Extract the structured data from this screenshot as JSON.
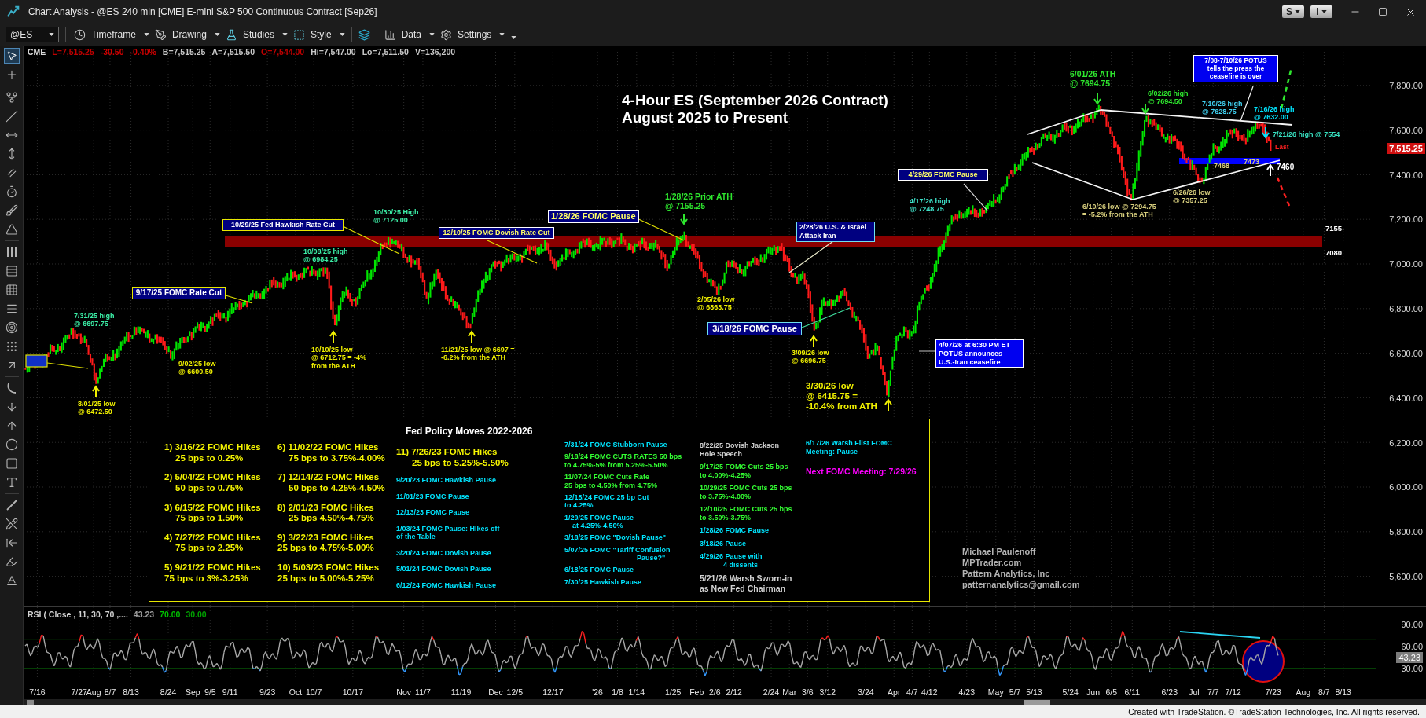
{
  "window": {
    "title": "Chart Analysis - @ES 240 min [CME] E-mini S&P 500 Continuous Contract [Sep26]",
    "buttons": [
      "S",
      "I"
    ]
  },
  "toolbar": {
    "symbol": "@ES",
    "menus": [
      "Timeframe",
      "Drawing",
      "Studies",
      "Style",
      "Data",
      "Settings"
    ]
  },
  "tools": [
    {
      "selected": true
    },
    {
      "selected": false
    },
    {
      "selected": false
    },
    {
      "selected": false
    },
    {
      "selected": false
    },
    {
      "selected": false
    },
    {
      "selected": false
    },
    {
      "selected": false
    },
    {
      "selected": false
    },
    {
      "selected": false
    },
    {
      "selected": false
    },
    {
      "selected": false
    },
    {
      "selected": false
    },
    {
      "selected": false
    },
    {
      "selected": false
    },
    {
      "selected": false
    },
    {
      "selected": false
    },
    {
      "selected": false
    },
    {
      "selected": false
    },
    {
      "selected": false
    },
    {
      "selected": false
    },
    {
      "selected": false
    },
    {
      "selected": false
    },
    {
      "selected": false
    },
    {
      "selected": false
    },
    {
      "selected": false
    },
    {
      "selected": false
    },
    {
      "selected": false
    }
  ],
  "quote": [
    {
      "text": "CME",
      "color": "#d8d8d8"
    },
    {
      "text": "L=7,515.25",
      "color": "#c00000"
    },
    {
      "text": "-30.50",
      "color": "#d00000"
    },
    {
      "text": "-0.40%",
      "color": "#d00000"
    },
    {
      "text": "B=7,515.25",
      "color": "#c8c8c8"
    },
    {
      "text": "A=7,515.50",
      "color": "#c8c8c8"
    },
    {
      "text": "O=7,544.00",
      "color": "#c00000"
    },
    {
      "text": "Hi=7,547.00",
      "color": "#c8c8c8"
    },
    {
      "text": "Lo=7,511.50",
      "color": "#c8c8c8"
    },
    {
      "text": "V=136,200",
      "color": "#c8c8c8"
    }
  ],
  "chart": {
    "title": [
      "4-Hour ES (September 2026 Contract)",
      "August 2025 to Present"
    ],
    "callouts": [
      {
        "lines": [
          "7/08-7/10/26 POTUS",
          "tells the press the",
          "ceasefire is over"
        ],
        "kind": "news"
      },
      {
        "lines": [
          "4/29/26 FOMC Pause"
        ],
        "kind": "fomc"
      },
      {
        "lines": [
          "10/29/25 Fed Hawkish Rate Cut"
        ],
        "kind": "fed"
      },
      {
        "lines": [
          "12/10/25 FOMC Dovish Rate Cut"
        ],
        "kind": "fomc"
      },
      {
        "lines": [
          "1/28/26 FOMC Pause"
        ],
        "kind": "fomc"
      },
      {
        "lines": [
          "2/28/26 U.S. & Israel",
          "Attack Iran"
        ],
        "kind": "event"
      },
      {
        "lines": [
          "9/17/25 FOMC Rate Cut"
        ],
        "kind": "fed"
      },
      {
        "lines": [
          "3/18/26 FOMC Pause"
        ],
        "kind": "event"
      },
      {
        "lines": [
          "4/07/26 at 6:30 PM ET",
          "POTUS announces",
          "U.S.-Iran ceasefire"
        ],
        "kind": "news"
      }
    ],
    "notes": [
      {
        "lines": [
          "6/01/26 ATH",
          "@ 7694.75"
        ],
        "color": "#2ee62e"
      },
      {
        "lines": [
          "6/02/26 high",
          "@ 7694.50"
        ],
        "color": "#2ee62e"
      },
      {
        "lines": [
          "7/10/26 high",
          "@ 7628.75"
        ],
        "color": "#40d0f0"
      },
      {
        "lines": [
          "7/16/26 high",
          "@ 7632.00"
        ],
        "color": "#00e5ff"
      },
      {
        "lines": [
          "7/21/26 high @ 7554"
        ],
        "color": "#38e0c0"
      },
      {
        "lines": [
          "Last"
        ],
        "color": "#ff2020"
      },
      {
        "lines": [
          "7460"
        ],
        "color": "#ffffff"
      },
      {
        "lines": [
          "4/17/26 high",
          "@ 7248.75"
        ],
        "color": "#3ee0c8"
      },
      {
        "lines": [
          "6/10/26 low @ 7294.75",
          "= -5.2% from the ATH"
        ],
        "color": "#d8cf7e"
      },
      {
        "lines": [
          "6/26/26 low",
          "@ 7357.25"
        ],
        "color": "#d8cf7e"
      },
      {
        "lines": [
          "1/28/26 Prior ATH",
          "@ 7155.25"
        ],
        "color": "#2ee62e"
      },
      {
        "lines": [
          "10/30/25 High",
          "@ 7125.00"
        ],
        "color": "#3cf0a8"
      },
      {
        "lines": [
          "10/08/25 high",
          "@ 6984.25"
        ],
        "color": "#3cf0a8"
      },
      {
        "lines": [
          "2/05/26 low",
          "@ 6863.75"
        ],
        "color": "#f0f000"
      },
      {
        "lines": [
          "7/31/25 high",
          "@ 6697.75"
        ],
        "color": "#3cf0a8"
      },
      {
        "lines": [
          "10/10/25 low",
          "@ 6712.75 = -4%",
          "from the ATH"
        ],
        "color": "#f0f000"
      },
      {
        "lines": [
          "11/21/25 low @ 6697 =",
          "-6.2% from the ATH"
        ],
        "color": "#f0f000"
      },
      {
        "lines": [
          "3/09/26 low",
          "@ 6696.75"
        ],
        "color": "#f0f000"
      },
      {
        "lines": [
          "9/02/25 low",
          "@ 6600.50"
        ],
        "color": "#f0f000"
      },
      {
        "lines": [
          "3/30/26 low",
          "@ 6415.75 =",
          "-10.4% from ATH"
        ],
        "color": "#f0f000"
      },
      {
        "lines": [
          "8/01/25 low",
          "@ 6472.50"
        ],
        "color": "#f0f000"
      }
    ],
    "zone_labels": [
      "7155-",
      "7080"
    ],
    "support_labels": [
      "7468",
      "7473"
    ],
    "price_axis": [
      "7,800.00",
      "7,600.00",
      "7,400.00",
      "7,200.00",
      "7,000.00",
      "6,800.00",
      "6,600.00",
      "6,400.00",
      "6,200.00",
      "6,000.00",
      "5,800.00",
      "5,600.00"
    ],
    "last_price": "7,515.25"
  },
  "fed_table": {
    "title": "Fed Policy Moves 2022-2026",
    "columns": [
      [
        {
          "lines": [
            "1) 3/16/22 FOMC Hikes",
            "25 bps to 0.25%"
          ],
          "color": "#f5f500",
          "kind": "large"
        },
        {
          "lines": [
            "2) 5/04/22 FOMC Hikes",
            "50 bps to 0.75%"
          ],
          "color": "#f5f500",
          "kind": "large"
        },
        {
          "lines": [
            "3) 6/15/22 FOMC Hikes",
            "75 bps to 1.50%"
          ],
          "color": "#f5f500",
          "kind": "large"
        },
        {
          "lines": [
            "4) 7/27/22 FOMC Hikes",
            "75 bps to 2.25%"
          ],
          "color": "#f5f500",
          "kind": "large"
        },
        {
          "lines": [
            "5) 9/21/22 FOMC Hikes",
            "75 bps to 3%-3.25%"
          ],
          "color": "#f5f500",
          "kind": "large"
        }
      ],
      [
        {
          "lines": [
            "6) 11/02/22 FOMC HIkes",
            "75 bps to 3.75%-4.00%"
          ],
          "color": "#f5f500",
          "kind": "large"
        },
        {
          "lines": [
            "7) 12/14/22 FOMC Hikes",
            "50 bps to 4.25%-4.50%"
          ],
          "color": "#f5f500",
          "kind": "large"
        },
        {
          "lines": [
            "8) 2/01/23 FOMC Hikes",
            "25 bps 4.50%-4.75%"
          ],
          "color": "#f5f500",
          "kind": "large"
        },
        {
          "lines": [
            "9) 3/22/23 FOMC Hikes",
            "25 bps to 4.75%-5.00%"
          ],
          "color": "#f5f500",
          "kind": "large"
        },
        {
          "lines": [
            "10) 5/03/23 FOMC Hikes",
            "25 bps to 5.00%-5.25%"
          ],
          "color": "#f5f500",
          "kind": "large"
        }
      ],
      [
        {
          "lines": [
            "11) 7/26/23 FOMC Hikes",
            "25 bps to 5.25%-5.50%"
          ],
          "color": "#f5f500",
          "kind": "large"
        },
        {
          "lines": [
            "9/20/23 FOMC Hawkish Pause"
          ],
          "color": "#00e5ff",
          "kind": "small"
        },
        {
          "lines": [
            "11/01/23 FOMC Pause"
          ],
          "color": "#00e5ff",
          "kind": "small"
        },
        {
          "lines": [
            "12/13/23 FOMC Pause"
          ],
          "color": "#00e5ff",
          "kind": "small"
        },
        {
          "lines": [
            "1/03/24 FOMC Pause: HIkes off",
            "of the Table"
          ],
          "color": "#00e5ff",
          "kind": "small"
        },
        {
          "lines": [
            "3/20/24 FOMC Dovish Pause"
          ],
          "color": "#00e5ff",
          "kind": "small"
        },
        {
          "lines": [
            "5/01/24 FOMC Dovish Pause"
          ],
          "color": "#00e5ff",
          "kind": "small"
        },
        {
          "lines": [
            "6/12/24 FOMC Hawkish Pause"
          ],
          "color": "#00e5ff",
          "kind": "small"
        }
      ],
      [
        {
          "lines": [
            "7/31/24 FOMC Stubborn Pause"
          ],
          "color": "#00e5ff",
          "kind": "small"
        },
        {
          "lines": [
            "9/18/24 FOMC CUTS RATES 50 bps",
            "to 4.75%-5% from 5.25%-5.50%"
          ],
          "color": "#33ff33",
          "kind": "small"
        },
        {
          "lines": [
            "11/07/24 FOMC Cuts Rate",
            "25 bps to 4.50% from 4.75%"
          ],
          "color": "#33ff33",
          "kind": "small"
        },
        {
          "lines": [
            "12/18/24 FOMC 25 bp Cut",
            "to 4.25%"
          ],
          "color": "#00e5ff",
          "kind": "small"
        },
        {
          "lines": [
            "1/29/25 FOMC Pause",
            "at 4.25%-4.50%"
          ],
          "color": "#00e5ff",
          "kind": "small"
        },
        {
          "lines": [
            "3/18/25 FOMC \"Dovish Pause\""
          ],
          "color": "#00e5ff",
          "kind": "small"
        },
        {
          "lines": [
            "5/07/25 FOMC \"Tariff Confusion",
            "Pause?\""
          ],
          "color": "#00e5ff",
          "kind": "small"
        },
        {
          "lines": [
            "6/18/25 FOMC Pause"
          ],
          "color": "#00e5ff",
          "kind": "small"
        },
        {
          "lines": [
            "7/30/25 Hawkish Pause"
          ],
          "color": "#00e5ff",
          "kind": "small"
        }
      ],
      [
        {
          "lines": [
            "8/22/25 Dovish Jackson",
            "Hole Speech"
          ],
          "color": "#d0d0d0",
          "kind": "small"
        },
        {
          "lines": [
            "9/17/25 FOMC Cuts 25 bps",
            "to 4.00%-4.25%"
          ],
          "color": "#33ff33",
          "kind": "small"
        },
        {
          "lines": [
            "10/29/25 FOMC Cuts 25 bps",
            "to 3.75%-4.00%"
          ],
          "color": "#33ff33",
          "kind": "small"
        },
        {
          "lines": [
            "12/10/25 FOMC Cuts 25 bps",
            "to 3.50%-3.75%"
          ],
          "color": "#33ff33",
          "kind": "small"
        },
        {
          "lines": [
            "1/28/26 FOMC Pause"
          ],
          "color": "#00e5ff",
          "kind": "small"
        },
        {
          "lines": [
            "3/18/26 Pause"
          ],
          "color": "#00e5ff",
          "kind": "small"
        },
        {
          "lines": [
            "4/29/26 Pause with",
            "4 dissents"
          ],
          "color": "#00e5ff",
          "kind": "small"
        },
        {
          "lines": [
            "5/21/26 Warsh Sworn-in",
            "as New Fed Chairman"
          ],
          "color": "#d0d0d0",
          "kind": "medium"
        }
      ],
      [
        {
          "lines": [
            "6/17/26 Warsh Fiist FOMC",
            "Meeting: Pause"
          ],
          "color": "#00e5ff",
          "kind": "small"
        },
        {
          "lines": [
            "Next FOMC Meeting: 7/29/26"
          ],
          "color": "#ff00ff",
          "kind": "medium"
        }
      ]
    ]
  },
  "signature": [
    "Michael Paulenoff",
    "MPTrader.com",
    "Pattern Analytics, Inc",
    "patternanalytics@gmail.com"
  ],
  "rsi": {
    "label": "RSI ( Close , 11, 30, 70 ,....",
    "readings": [
      {
        "text": "43.23",
        "color": "#a0a0a0"
      },
      {
        "text": "70.00",
        "color": "#00c000"
      },
      {
        "text": "30.00",
        "color": "#00a000"
      }
    ],
    "axis": [
      "90.00",
      "60.00",
      "30.00"
    ],
    "last_value": "43.23"
  },
  "date_axis": [
    "7/16",
    "7/27",
    "Aug",
    "8/7",
    "8/13",
    "8/24",
    "Sep",
    "9/5",
    "9/11",
    "9/23",
    "Oct",
    "10/7",
    "10/17",
    "Nov",
    "11/7",
    "11/19",
    "Dec",
    "12/5",
    "12/17",
    "'26",
    "1/8",
    "1/14",
    "1/25",
    "Feb",
    "2/6",
    "2/12",
    "2/24",
    "Mar",
    "3/6",
    "3/12",
    "3/24",
    "Apr",
    "4/7",
    "4/12",
    "4/23",
    "May",
    "5/7",
    "5/13",
    "5/24",
    "Jun",
    "6/5",
    "6/11",
    "6/23",
    "Jul",
    "7/7",
    "7/12",
    "7/23",
    "Aug",
    "8/7",
    "8/13"
  ],
  "footer": "Created with TradeStation. ©TradeStation Technologies, Inc. All rights reserved."
}
